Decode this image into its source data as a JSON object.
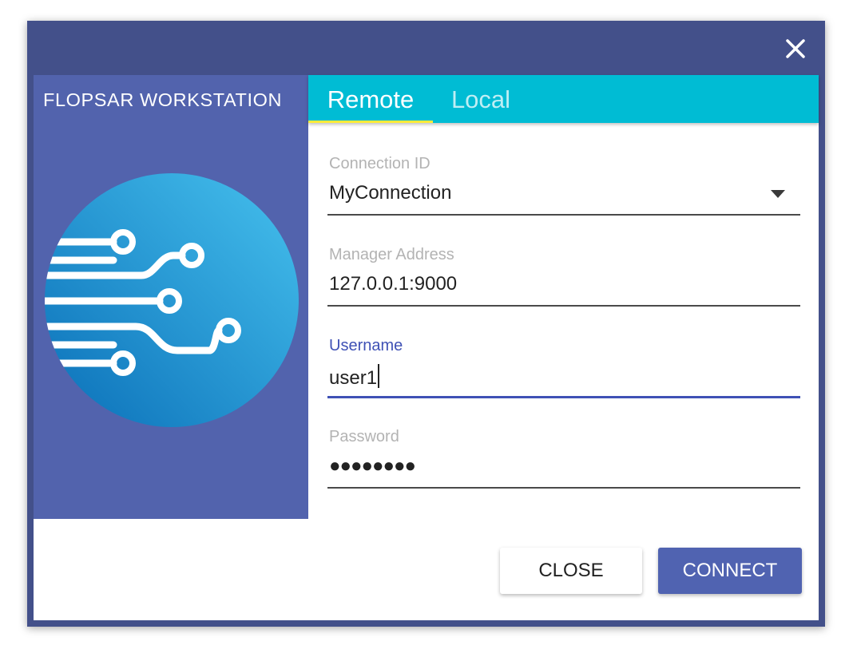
{
  "window": {
    "close_icon": "close-icon"
  },
  "sidebar": {
    "brand": "FLOPSAR WORKSTATION",
    "logo_icon": "circuit-logo-icon"
  },
  "tabs": [
    {
      "label": "Remote",
      "active": true
    },
    {
      "label": "Local",
      "active": false
    }
  ],
  "form": {
    "connection_id": {
      "label": "Connection ID",
      "value": "MyConnection",
      "icon": "dropdown-arrow-icon"
    },
    "manager_address": {
      "label": "Manager Address",
      "value": "127.0.0.1:9000"
    },
    "username": {
      "label": "Username",
      "value": "user1",
      "focused": true
    },
    "password": {
      "label": "Password",
      "value": "●●●●●●●●"
    }
  },
  "buttons": {
    "close": "CLOSE",
    "connect": "CONNECT"
  },
  "colors": {
    "window_frame": "#43508a",
    "sidebar": "#5263ad",
    "tab_bar": "#00bcd4",
    "tab_indicator": "#ffeb3b",
    "focus": "#3f51b5",
    "connect_button": "#5063b1"
  }
}
